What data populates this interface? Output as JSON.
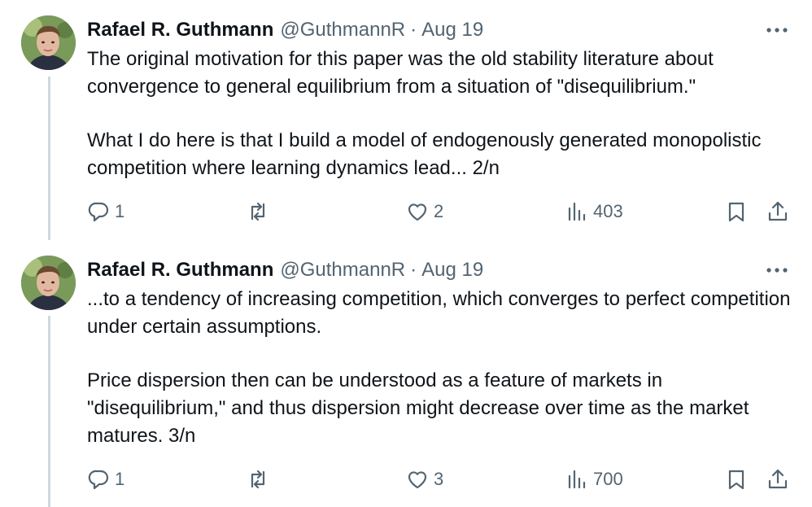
{
  "tweets": [
    {
      "author": "Rafael R. Guthmann",
      "handle": "@GuthmannR",
      "separator": "·",
      "date": "Aug 19",
      "paragraphs": [
        "The original motivation for this paper was the old stability literature about convergence to general equilibrium from a situation of \"disequilibrium.\"",
        "What I do here is that I build a model of endogenously generated monopolistic competition where learning dynamics lead... 2/n"
      ],
      "replies": "1",
      "reposts": "",
      "likes": "2",
      "views": "403"
    },
    {
      "author": "Rafael R. Guthmann",
      "handle": "@GuthmannR",
      "separator": "·",
      "date": "Aug 19",
      "paragraphs": [
        "...to a tendency of increasing competition, which converges to perfect competition under certain assumptions.",
        "Price dispersion then can be understood as a feature of markets in \"disequilibrium,\" and thus dispersion might decrease over time as the market matures. 3/n"
      ],
      "replies": "1",
      "reposts": "",
      "likes": "3",
      "views": "700"
    }
  ],
  "icons": {
    "reply": "reply-icon",
    "repost": "repost-icon",
    "like": "heart-icon",
    "views": "analytics-icon",
    "bookmark": "bookmark-icon",
    "share": "share-icon",
    "more": "more-icon"
  },
  "colors": {
    "text": "#0f1419",
    "secondary": "#536471",
    "thread_line": "#cfd9de"
  }
}
